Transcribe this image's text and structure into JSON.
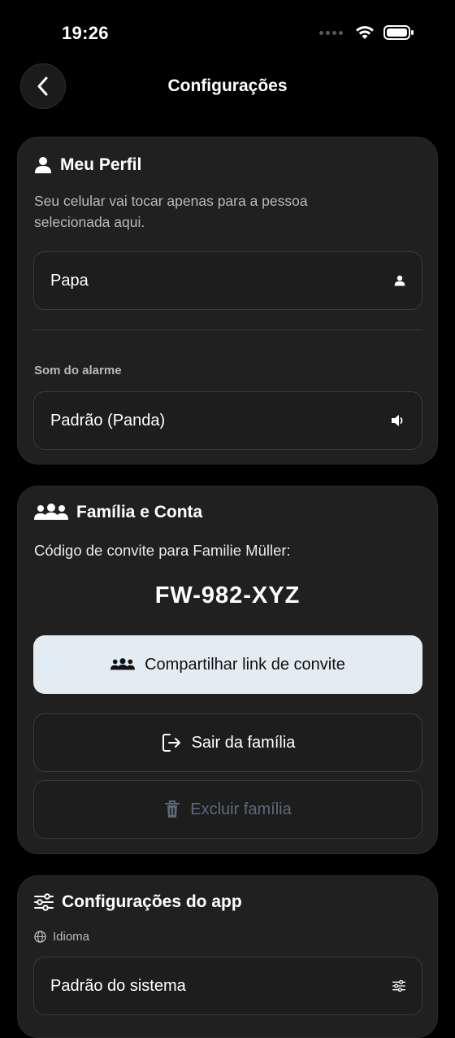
{
  "status_bar": {
    "time": "19:26"
  },
  "nav": {
    "title": "Configurações"
  },
  "profile": {
    "title": "Meu Perfil",
    "description": "Seu celular vai tocar apenas para a pessoa selecionada aqui.",
    "person_value": "Papa",
    "alarm_label": "Som do alarme",
    "alarm_value": "Padrão (Panda)"
  },
  "family": {
    "title": "Família e Conta",
    "invite_text": "Código de convite para Familie Müller:",
    "invite_code": "FW-982-XYZ",
    "share_label": "Compartilhar link de convite",
    "leave_label": "Sair da família",
    "delete_label": "Excluir família"
  },
  "app_settings": {
    "title": "Configurações do app",
    "language_label": "Idioma",
    "language_value": "Padrão do sistema"
  },
  "colors": {
    "background": "#000000",
    "card": "#202020",
    "primary_button": "#e3ebf3",
    "disabled_text": "#5c6a7a"
  }
}
